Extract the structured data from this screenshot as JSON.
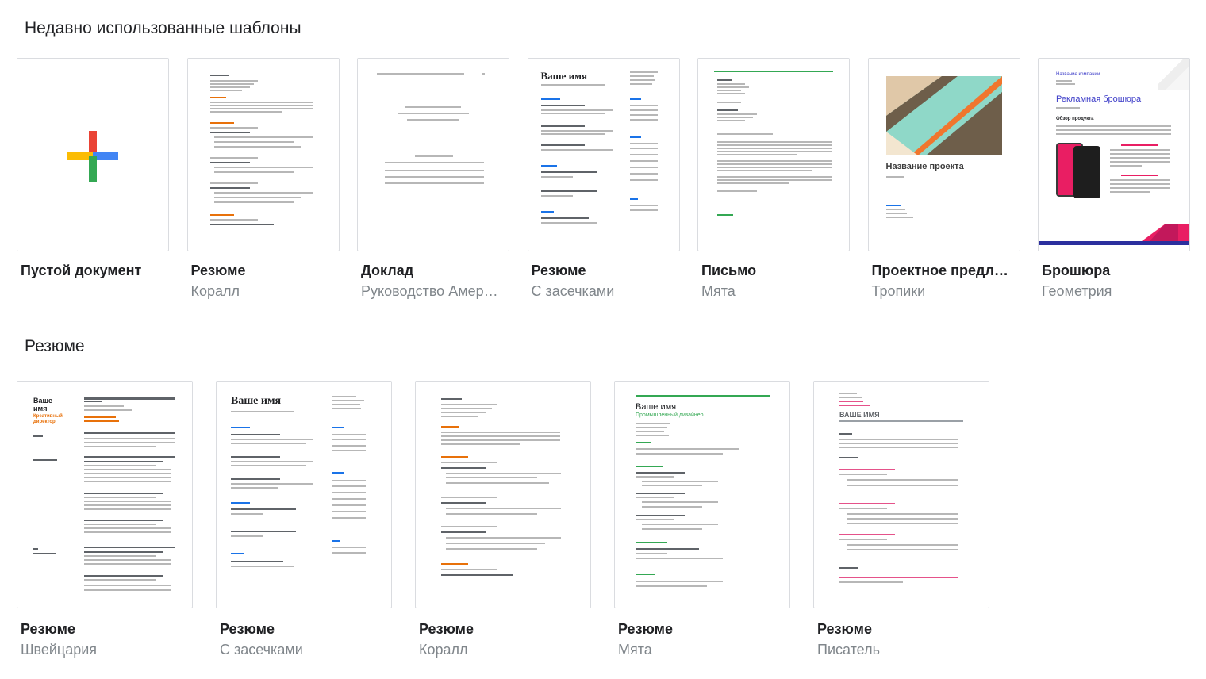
{
  "sections": {
    "recent_title": "Недавно использованные шаблоны",
    "resume_title": "Резюме"
  },
  "recent": [
    {
      "title": "Пустой документ",
      "subtitle": ""
    },
    {
      "title": "Резюме",
      "subtitle": "Коралл"
    },
    {
      "title": "Доклад",
      "subtitle": "Руководство Амер…"
    },
    {
      "title": "Резюме",
      "subtitle": "С засечками"
    },
    {
      "title": "Письмо",
      "subtitle": "Мята"
    },
    {
      "title": "Проектное предл…",
      "subtitle": "Тропики"
    },
    {
      "title": "Брошюра",
      "subtitle": "Геометрия"
    }
  ],
  "resumes": [
    {
      "title": "Резюме",
      "subtitle": "Швейцария"
    },
    {
      "title": "Резюме",
      "subtitle": "С засечками"
    },
    {
      "title": "Резюме",
      "subtitle": "Коралл"
    },
    {
      "title": "Резюме",
      "subtitle": "Мята"
    },
    {
      "title": "Резюме",
      "subtitle": "Писатель"
    }
  ],
  "previews": {
    "serif_name": "Ваше имя",
    "project_name": "Название проекта",
    "brochure_title": "Рекламная брошюра",
    "brochure_company": "Название компании",
    "brochure_overview": "Обзор продукта",
    "swiss_name": "Ваше имя",
    "swiss_role": "Креативный директор",
    "mint_name": "Ваше имя",
    "mint_role": "Промышленный дизайнер",
    "writer_name": "ВАШЕ ИМЯ"
  },
  "colors": {
    "coral": "#e8710a",
    "mint": "#34a853",
    "blue": "#1a73e8",
    "brochure_purple": "#3c3cc8",
    "brochure_pink": "#e91e63",
    "tropic_teal": "#8fd8c8",
    "tropic_orange": "#f0762e",
    "tropic_brown": "#6e5e4a",
    "writer_pink": "#e5528a"
  }
}
